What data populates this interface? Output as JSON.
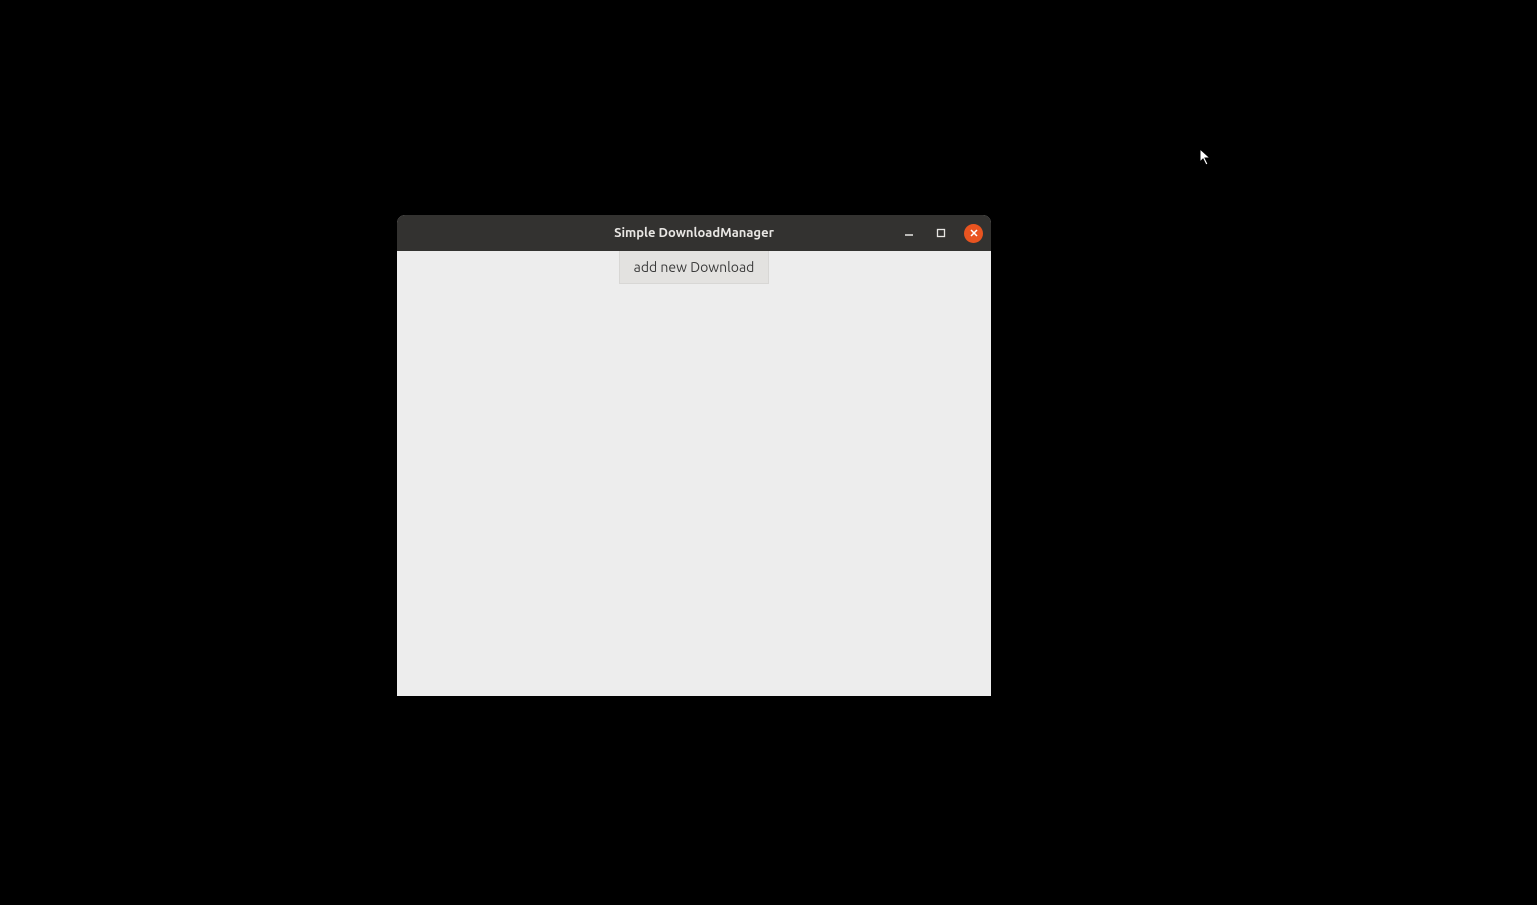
{
  "window": {
    "title": "Simple DownloadManager",
    "add_button_label": "add new Download"
  }
}
